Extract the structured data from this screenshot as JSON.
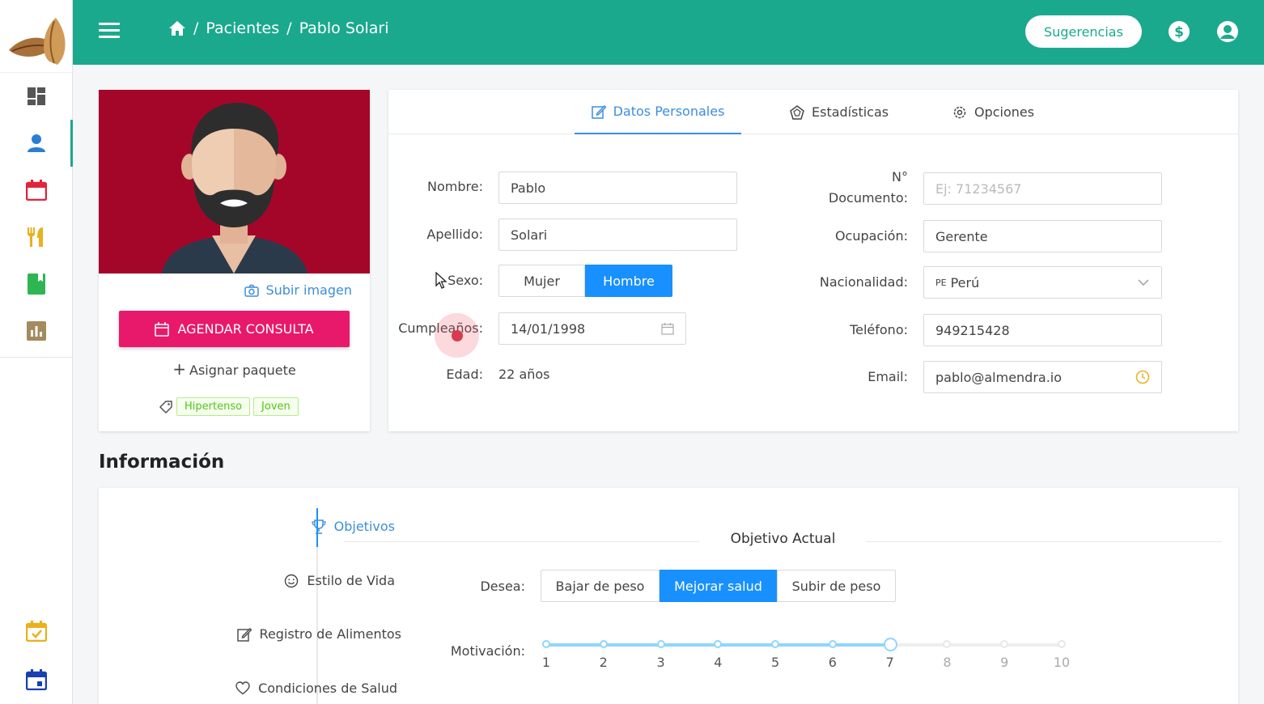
{
  "header": {
    "breadcrumb": [
      "Pacientes",
      "Pablo Solari"
    ],
    "suggestions_label": "Sugerencias"
  },
  "profile": {
    "upload_label": "Subir imagen",
    "schedule_label": "AGENDAR CONSULTA",
    "assign_label": "Asignar paquete",
    "tags": [
      "Hipertenso",
      "Joven"
    ]
  },
  "tabs": [
    "Datos Personales",
    "Estadísticas",
    "Opciones"
  ],
  "form": {
    "nombre_label": "Nombre:",
    "nombre": "Pablo",
    "apellido_label": "Apellido:",
    "apellido": "Solari",
    "sexo_label": "Sexo:",
    "sexo_options": [
      "Mujer",
      "Hombre"
    ],
    "sexo_selected": "Hombre",
    "cumple_label": "Cumpleaños:",
    "cumple": "14/01/1998",
    "edad_label": "Edad:",
    "edad": "22 años",
    "doc_label_1": "N°",
    "doc_label_2": "Documento:",
    "doc_placeholder": "Ej: 71234567",
    "ocupacion_label": "Ocupación:",
    "ocupacion": "Gerente",
    "nacionalidad_label": "Nacionalidad:",
    "nacionalidad_code": "PE",
    "nacionalidad": "Perú",
    "telefono_label": "Teléfono:",
    "telefono": "949215428",
    "email_label": "Email:",
    "email": "pablo@almendra.io"
  },
  "info": {
    "title": "Información",
    "menu": [
      "Objetivos",
      "Estilo de Vida",
      "Registro de Alimentos",
      "Condiciones de Salud"
    ],
    "section_title": "Objetivo Actual",
    "desea_label": "Desea:",
    "desea_options": [
      "Bajar de peso",
      "Mejorar salud",
      "Subir de peso"
    ],
    "desea_selected": "Mejorar salud",
    "motivacion_label": "Motivación:",
    "motivacion_marks": [
      "1",
      "2",
      "3",
      "4",
      "5",
      "6",
      "7",
      "8",
      "9",
      "10"
    ],
    "motivacion_value": 7
  },
  "colors": {
    "brand": "#1ba98e",
    "primary": "#1890ff",
    "accent": "#e8196a",
    "avatar_bg": "#a4062a"
  }
}
